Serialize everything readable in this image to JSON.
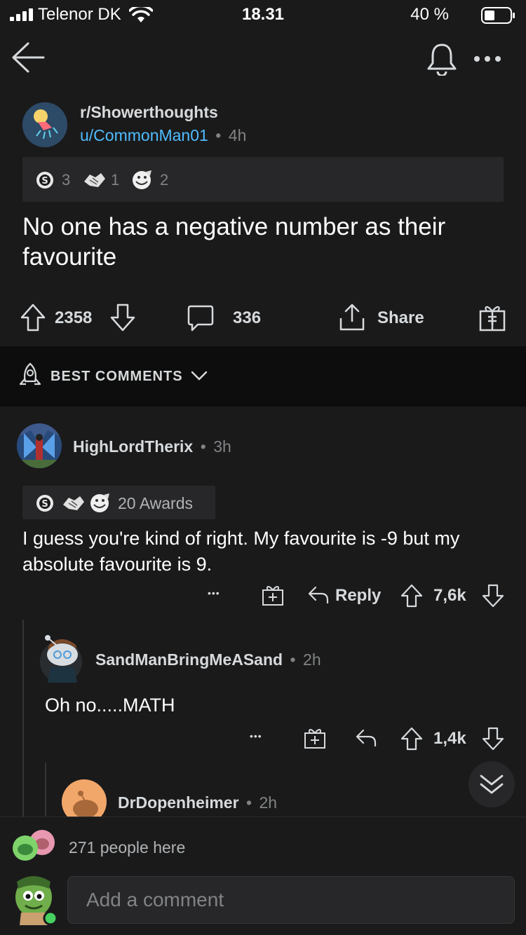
{
  "status_bar": {
    "carrier": "Telenor DK",
    "time": "18.31",
    "battery": "40 %"
  },
  "post": {
    "subreddit": "r/Showerthoughts",
    "author": "u/CommonMan01",
    "separator": "•",
    "age": "4h",
    "awards": [
      {
        "icon": "silver-award-icon",
        "count": "3"
      },
      {
        "icon": "handshake-award-icon",
        "count": "1"
      },
      {
        "icon": "wholesome-award-icon",
        "count": "2"
      }
    ],
    "title": "No one has a negative number as their favourite",
    "score": "2358",
    "comments_count": "336",
    "share_label": "Share"
  },
  "sort": {
    "label": "BEST COMMENTS"
  },
  "comments": [
    {
      "author": "HighLordTherix",
      "separator": "•",
      "age": "3h",
      "awards_label": "20 Awards",
      "body": "I guess you're kind of right. My favourite is -9 but my absolute favourite is 9.",
      "more": "•••",
      "reply_label": "Reply",
      "score": "7,6k"
    },
    {
      "author": "SandManBringMeASand",
      "separator": "•",
      "age": "2h",
      "body": "Oh no.....MATH",
      "more": "•••",
      "score": "1,4k"
    },
    {
      "author": "DrDopenheimer",
      "separator": "•",
      "age": "2h"
    }
  ],
  "bottom": {
    "presence": "271 people here",
    "comment_placeholder": "Add a comment"
  },
  "colors": {
    "background": "#1a1a1b",
    "link_blue": "#4fbcff",
    "muted": "#818384",
    "online_green": "#46d160"
  }
}
